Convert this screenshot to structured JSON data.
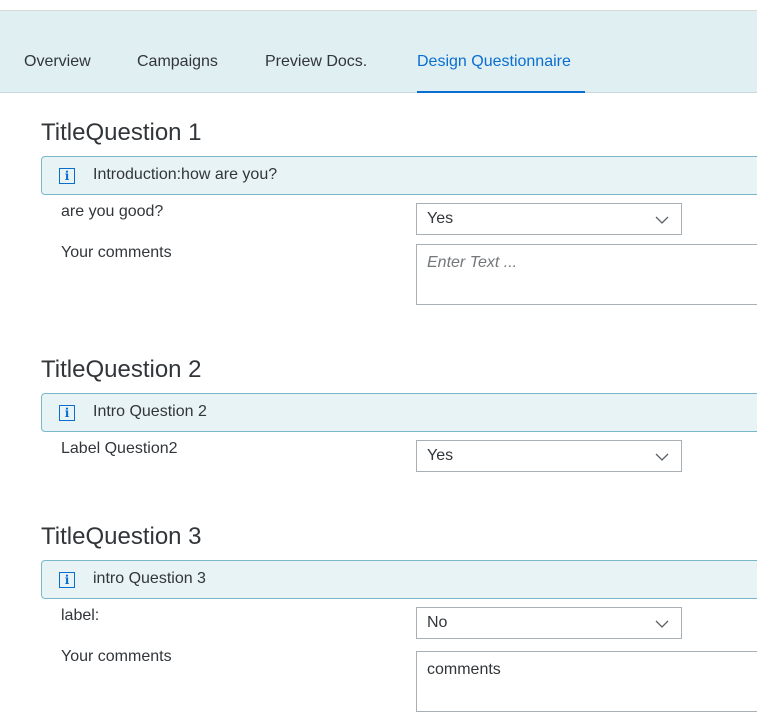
{
  "tabs": [
    {
      "label": "Overview",
      "active": false
    },
    {
      "label": "Campaigns",
      "active": false
    },
    {
      "label": "Preview Docs.",
      "active": false
    },
    {
      "label": "Design Questionnaire",
      "active": true
    }
  ],
  "questions": [
    {
      "title": "TitleQuestion 1",
      "intro": "Introduction:how are you?",
      "select_label": "are you good?",
      "select_value": "Yes",
      "comments_label": "Your comments",
      "comments_placeholder": "Enter Text ..."
    },
    {
      "title": "TitleQuestion 2",
      "intro": "Intro Question 2",
      "select_label": "Label Question2",
      "select_value": "Yes"
    },
    {
      "title": "TitleQuestion 3",
      "intro": "intro Question 3",
      "select_label": "label:",
      "select_value": "No",
      "comments_label": "Your comments",
      "comments_value": "comments"
    }
  ],
  "icons": {
    "info": "info-icon",
    "dropdown": "chevron-down-icon"
  },
  "colors": {
    "accent": "#0a6ed1",
    "tabbar_bg": "#e0eff2",
    "intro_bg": "#e8f3f6",
    "intro_border": "#7ab8c9"
  }
}
